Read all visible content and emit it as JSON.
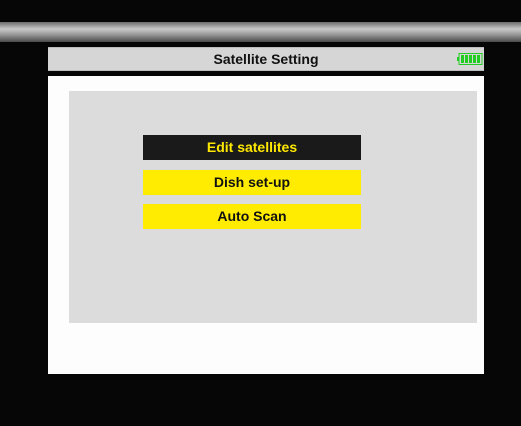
{
  "header": {
    "title": "Satellite Setting",
    "battery_icon": "battery-full-icon",
    "battery_color": "#22cc22",
    "battery_level": 1.0
  },
  "menu": {
    "items": [
      {
        "label": "Edit satellites",
        "selected": true
      },
      {
        "label": "Dish set-up",
        "selected": false
      },
      {
        "label": "Auto Scan",
        "selected": false
      }
    ],
    "selected_bg": "#1a1a1a",
    "selected_fg": "#ffe800",
    "normal_bg": "#ffec00",
    "normal_fg": "#111111"
  }
}
